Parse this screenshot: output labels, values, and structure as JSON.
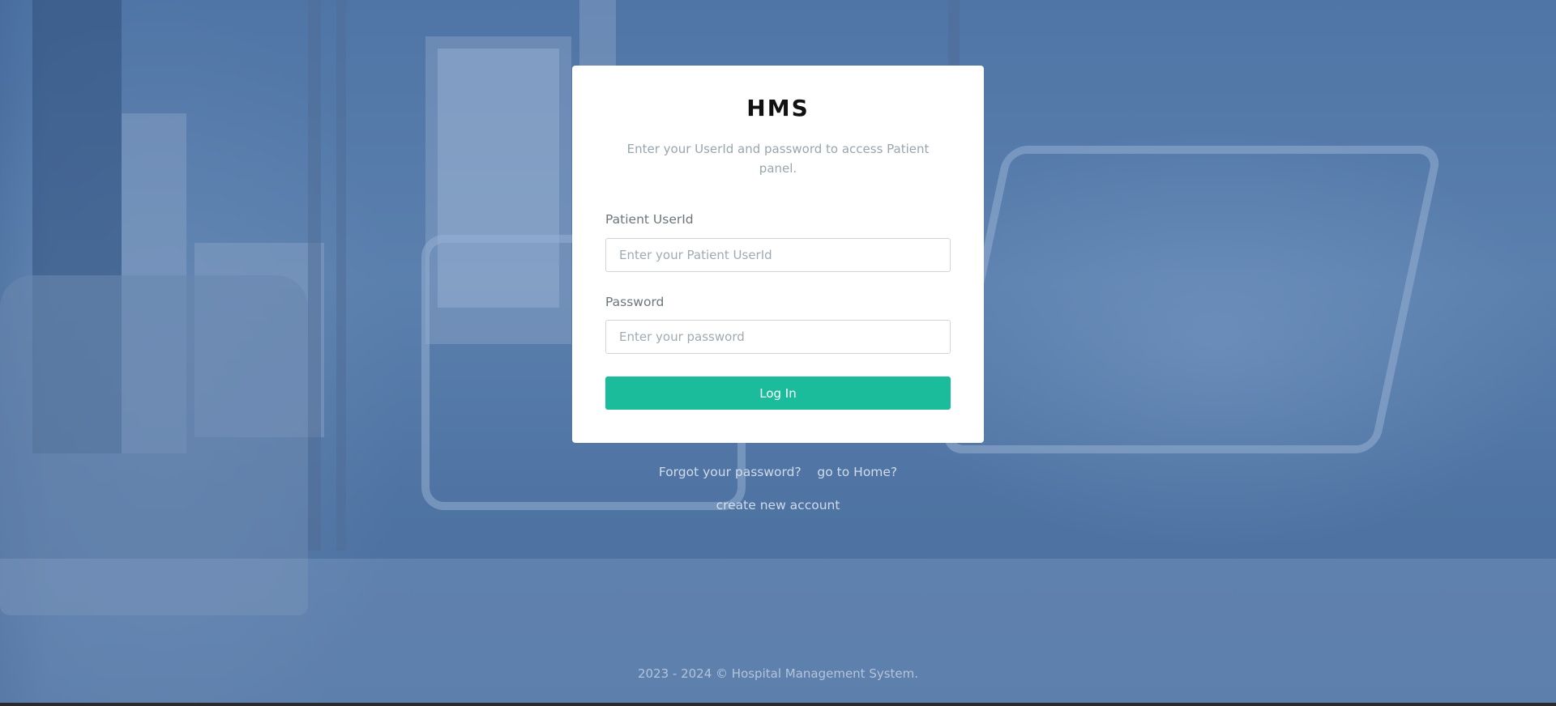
{
  "logo": {
    "text": "HMS"
  },
  "intro_text": "Enter your UserId and password to access Patient panel.",
  "form": {
    "userid_label": "Patient UserId",
    "userid_placeholder": "Enter your Patient UserId",
    "password_label": "Password",
    "password_placeholder": "Enter your password",
    "login_button": "Log In"
  },
  "links": {
    "forgot_password": "Forgot your password?",
    "go_home": "go to Home?",
    "create_account": "create new account"
  },
  "footer": {
    "text": "2023 - 2024 © Hospital Management System."
  },
  "colors": {
    "accent": "#1abc9c",
    "background_overlay": "#4f75a6",
    "card": "#ffffff"
  }
}
